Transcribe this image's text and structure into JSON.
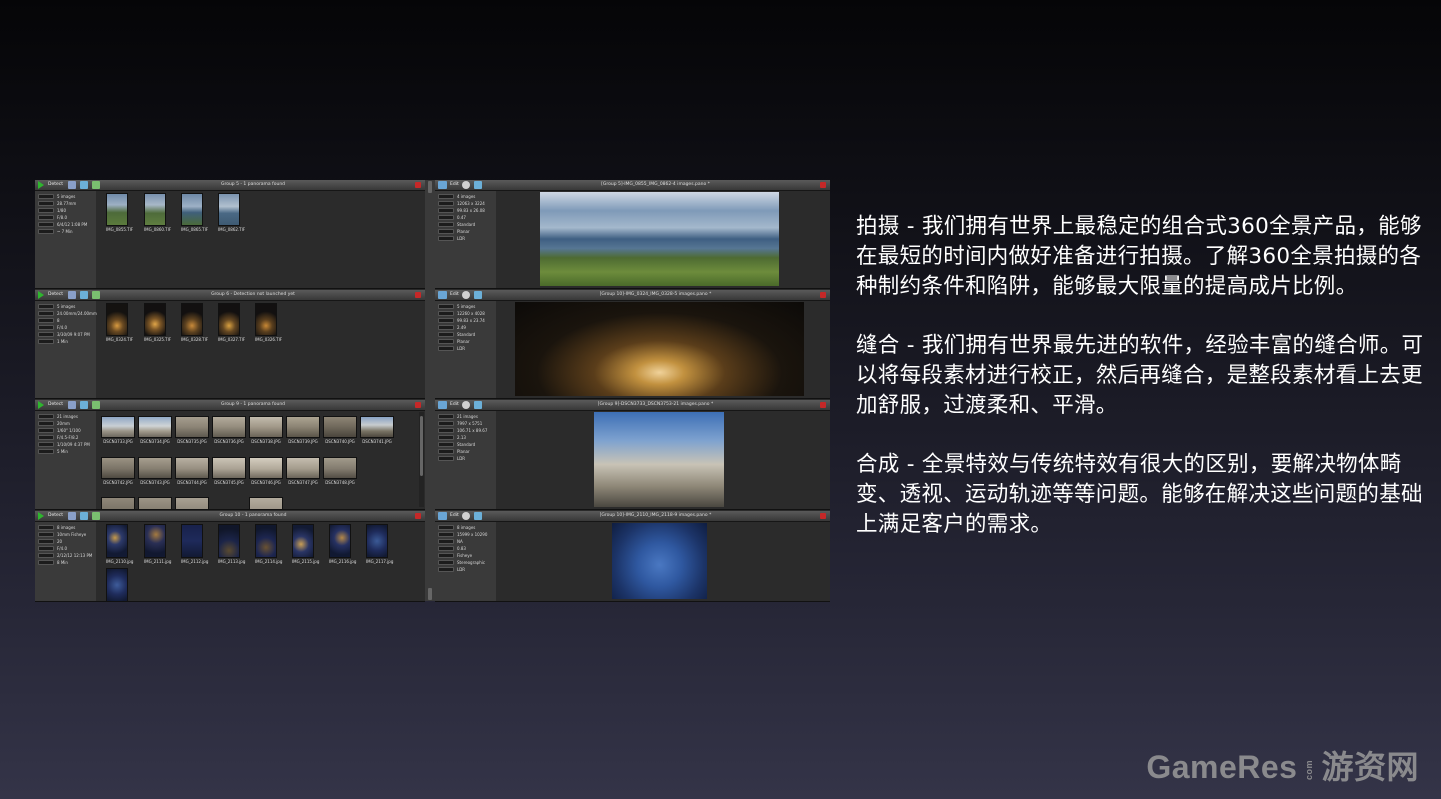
{
  "left_groups": [
    {
      "title": "Group 5 - 1 panorama found",
      "detect_label": "Detect",
      "info": [
        "5 images",
        "28.77mm",
        "1/80",
        "F/8.0",
        "6/4/12 1:08 PM",
        "~ 7 Min"
      ],
      "thumbs": [
        "IMG_0855.TIF",
        "IMG_0860.TIF",
        "IMG_0865.TIF",
        "IMG_0862.TIF"
      ]
    },
    {
      "title": "Group 6 - Detection not launched yet",
      "detect_label": "Detect",
      "info": [
        "5 images",
        "24.00mm/24.00mm",
        "8",
        "F/4.0",
        "3/30/09 9:07 PM",
        "1 Min"
      ],
      "thumbs": [
        "IMG_0324.TIF",
        "IMG_0325.TIF",
        "IMG_0328.TIF",
        "IMG_0327.TIF",
        "IMG_0326.TIF"
      ]
    },
    {
      "title": "Group 9 - 1 panorama found",
      "detect_label": "Detect",
      "info": [
        "21 images",
        "20mm",
        "1/60\" 1/100",
        "F/4.5-F/8.2",
        "1/10/09 4:37 PM",
        "5 Min"
      ],
      "thumbs": [
        "DSCN3733.JPG",
        "DSCN3734.JPG",
        "DSCN3735.JPG",
        "DSCN3736.JPG",
        "DSCN3738.JPG",
        "DSCN3739.JPG",
        "DSCN3740.JPG",
        "DSCN3741.JPG",
        "DSCN3742.JPG",
        "DSCN3743.JPG",
        "DSCN3744.JPG",
        "DSCN3745.JPG",
        "DSCN3746.JPG",
        "DSCN3747.JPG",
        "DSCN3748.JPG"
      ]
    },
    {
      "title": "Group 10 - 1 panorama found",
      "detect_label": "Detect",
      "info": [
        "8 images",
        "10mm Fisheye",
        "20",
        "F/4.0",
        "2/12/12 12:13 PM",
        "8 Min"
      ],
      "thumbs": [
        "IMG_2110.jpg",
        "IMG_2111.jpg",
        "IMG_2112.jpg",
        "IMG_2113.jpg",
        "IMG_2114.jpg",
        "IMG_2115.jpg",
        "IMG_2116.jpg",
        "IMG_2117.jpg"
      ]
    }
  ],
  "right_groups": [
    {
      "title": "[Group 5]-IMG_0855_IMG_0862-4 images.pano *",
      "edit_label": "Edit",
      "info": [
        "4 images",
        "12063 x 3224",
        "99.83 x 26.08",
        "0.47",
        "Standard",
        "Planar",
        "LDR"
      ]
    },
    {
      "title": "[Group 10]-IMG_0324_IMG_0328-5 images.pano *",
      "edit_label": "Edit",
      "info": [
        "5 images",
        "12260 x 4028",
        "99.83 x 23.74",
        "2.49",
        "Standard",
        "Planar",
        "LDR"
      ]
    },
    {
      "title": "[Group 9]-DSCN3733_DSCN3753-21 images.pano *",
      "edit_label": "Edit",
      "info": [
        "21 images",
        "7997 x 5751",
        "106.71 x 89.67",
        "2.13",
        "Standard",
        "Planar",
        "LDR"
      ]
    },
    {
      "title": "[Group 10]-IMG_2110_IMG_2118-9 images.pano *",
      "edit_label": "Edit",
      "info": [
        "8 images",
        "15999 x 10290",
        "NA",
        "0.83",
        "Fisheye",
        "Stereographic",
        "LDR"
      ]
    }
  ],
  "text": {
    "p1": "拍摄 - 我们拥有世界上最稳定的组合式360全景产品，能够在最短的时间内做好准备进行拍摄。了解360全景拍摄的各种制约条件和陷阱，能够最大限量的提高成片比例。",
    "p2": "缝合 - 我们拥有世界最先进的软件，经验丰富的缝合师。可以将每段素材进行校正，然后再缝合，是整段素材看上去更加舒服，过渡柔和、平滑。",
    "p3": "合成 - 全景特效与传统特效有很大的区别，要解决物体畸变、透视、运动轨迹等等问题。能够在解决这些问题的基础上满足客户的需求。"
  },
  "watermark": {
    "brand": "GameRes",
    "domain": "com",
    "cn": "游资网"
  }
}
